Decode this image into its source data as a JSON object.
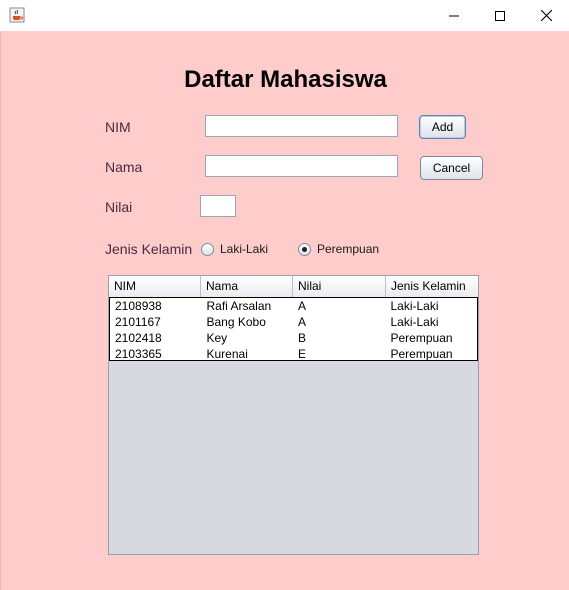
{
  "window": {
    "app_icon": "java-coffee-icon",
    "controls": [
      "minimize-icon",
      "maximize-icon",
      "close-icon"
    ]
  },
  "form": {
    "title": "Daftar Mahasiswa",
    "nim_label": "NIM",
    "nim_value": "",
    "nama_label": "Nama",
    "nama_value": "",
    "nilai_label": "Nilai",
    "nilai_value": "",
    "add_label": "Add",
    "cancel_label": "Cancel",
    "gender_label": "Jenis Kelamin",
    "gender_options": [
      {
        "label": "Laki-Laki",
        "selected": false
      },
      {
        "label": "Perempuan",
        "selected": true
      }
    ]
  },
  "table": {
    "columns": [
      "NIM",
      "Nama",
      "Nilai",
      "Jenis Kelamin"
    ],
    "rows": [
      [
        "2108938",
        "Rafi Arsalan",
        "A",
        "Laki-Laki"
      ],
      [
        "2101167",
        "Bang Kobo",
        "A",
        "Laki-Laki"
      ],
      [
        "2102418",
        "Key",
        "B",
        "Perempuan"
      ],
      [
        "2103365",
        "Kurenai",
        "E",
        "Perempuan"
      ]
    ]
  },
  "colors": {
    "background": "#ffcccc",
    "table_area": "#d6d9e0"
  }
}
